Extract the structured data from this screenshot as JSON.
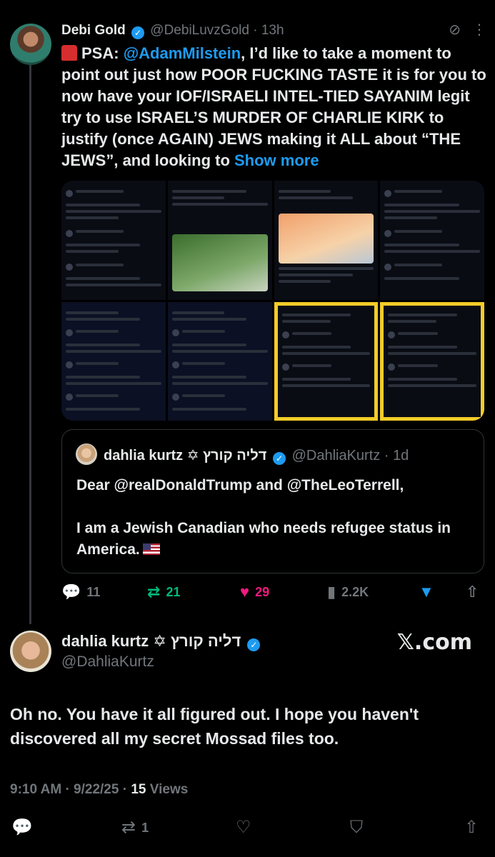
{
  "tweet": {
    "author_name": "Debi Gold",
    "author_handle": "@DebiLuvzGold",
    "time_ago": "13h",
    "text_prefix": "PSA: ",
    "mention": "@AdamMilstein",
    "text_body": ", I’d like to take a moment to point out just how POOR FUCKING TASTE it is for you to now have your IOF/ISRAELI INTEL-TIED SAYANIM legit try to use ISRAEL’S MURDER OF CHARLIE KIRK to justify (once AGAIN) JEWS making it ALL about “THE JEWS”, and looking to ",
    "show_more": "Show more",
    "icons": {
      "grok": "grok-icon",
      "more": "more-icon",
      "siren": "siren-emoji"
    }
  },
  "quote": {
    "author_name": "dahlia kurtz ✡ דליה קורץ",
    "author_handle": "@DahliaKurtz",
    "time_ago": "1d",
    "text_line1": "Dear @realDonaldTrump and @TheLeoTerrell,",
    "text_line2": "I am a Jewish Canadian who needs refugee status in America."
  },
  "actions": {
    "replies": "11",
    "reposts": "21",
    "likes": "29",
    "views": "2.2K",
    "colors": {
      "repost": "#00ba7c",
      "like": "#f91880",
      "bookmark": "#1d9bf0"
    }
  },
  "reply": {
    "author_name": "dahlia kurtz ✡ דליה קורץ",
    "author_handle": "@DahliaKurtz",
    "watermark": "𝕏.com",
    "text": "Oh no. You have it all figured out. I hope you haven't discovered all my secret Mossad files too.",
    "time": "9:10 AM",
    "date": "9/22/25",
    "views_count": "15",
    "views_label": "Views",
    "repost_count": "1"
  }
}
